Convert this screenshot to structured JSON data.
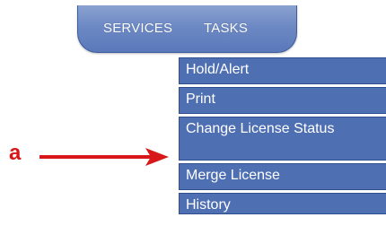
{
  "tabs": [
    {
      "label": "SERVICES"
    },
    {
      "label": "TASKS"
    }
  ],
  "menu": {
    "items": [
      {
        "label": "Hold/Alert"
      },
      {
        "label": "Print"
      },
      {
        "label": "Change License Status"
      },
      {
        "label": "Merge License"
      },
      {
        "label": "History"
      }
    ]
  },
  "annotation": {
    "label": "a",
    "color": "#d81818"
  },
  "colors": {
    "tab_bar": "#6d89c4",
    "menu_item": "#4f6fb3",
    "menu_border": "#2f4f8f",
    "text": "#ffffff"
  }
}
